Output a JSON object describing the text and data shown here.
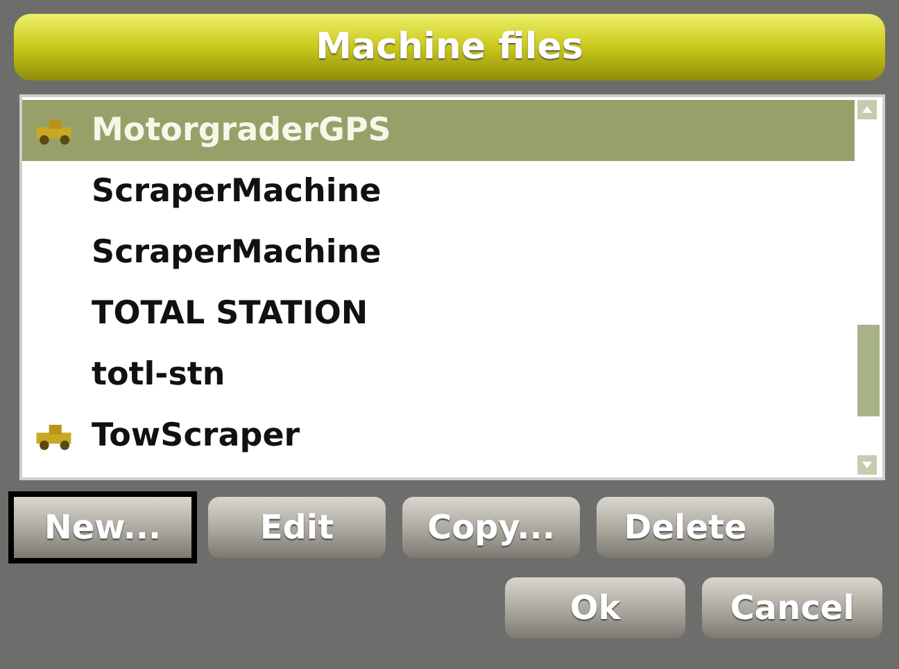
{
  "window": {
    "title": "Machine files"
  },
  "files": [
    {
      "name": "MotorgraderGPS",
      "selected": true,
      "icon": true
    },
    {
      "name": "ScraperMachine",
      "selected": false,
      "icon": false
    },
    {
      "name": "ScraperMachine",
      "selected": false,
      "icon": false
    },
    {
      "name": "TOTAL STATION",
      "selected": false,
      "icon": false
    },
    {
      "name": "totl-stn",
      "selected": false,
      "icon": false
    },
    {
      "name": "TowScraper",
      "selected": false,
      "icon": true
    }
  ],
  "actions": [
    {
      "label": "New...",
      "focused": true
    },
    {
      "label": "Edit",
      "focused": false
    },
    {
      "label": "Copy...",
      "focused": false
    },
    {
      "label": "Delete",
      "focused": false
    }
  ],
  "dialog_buttons": [
    {
      "label": "Ok",
      "focused": false
    },
    {
      "label": "Cancel",
      "focused": false
    }
  ]
}
